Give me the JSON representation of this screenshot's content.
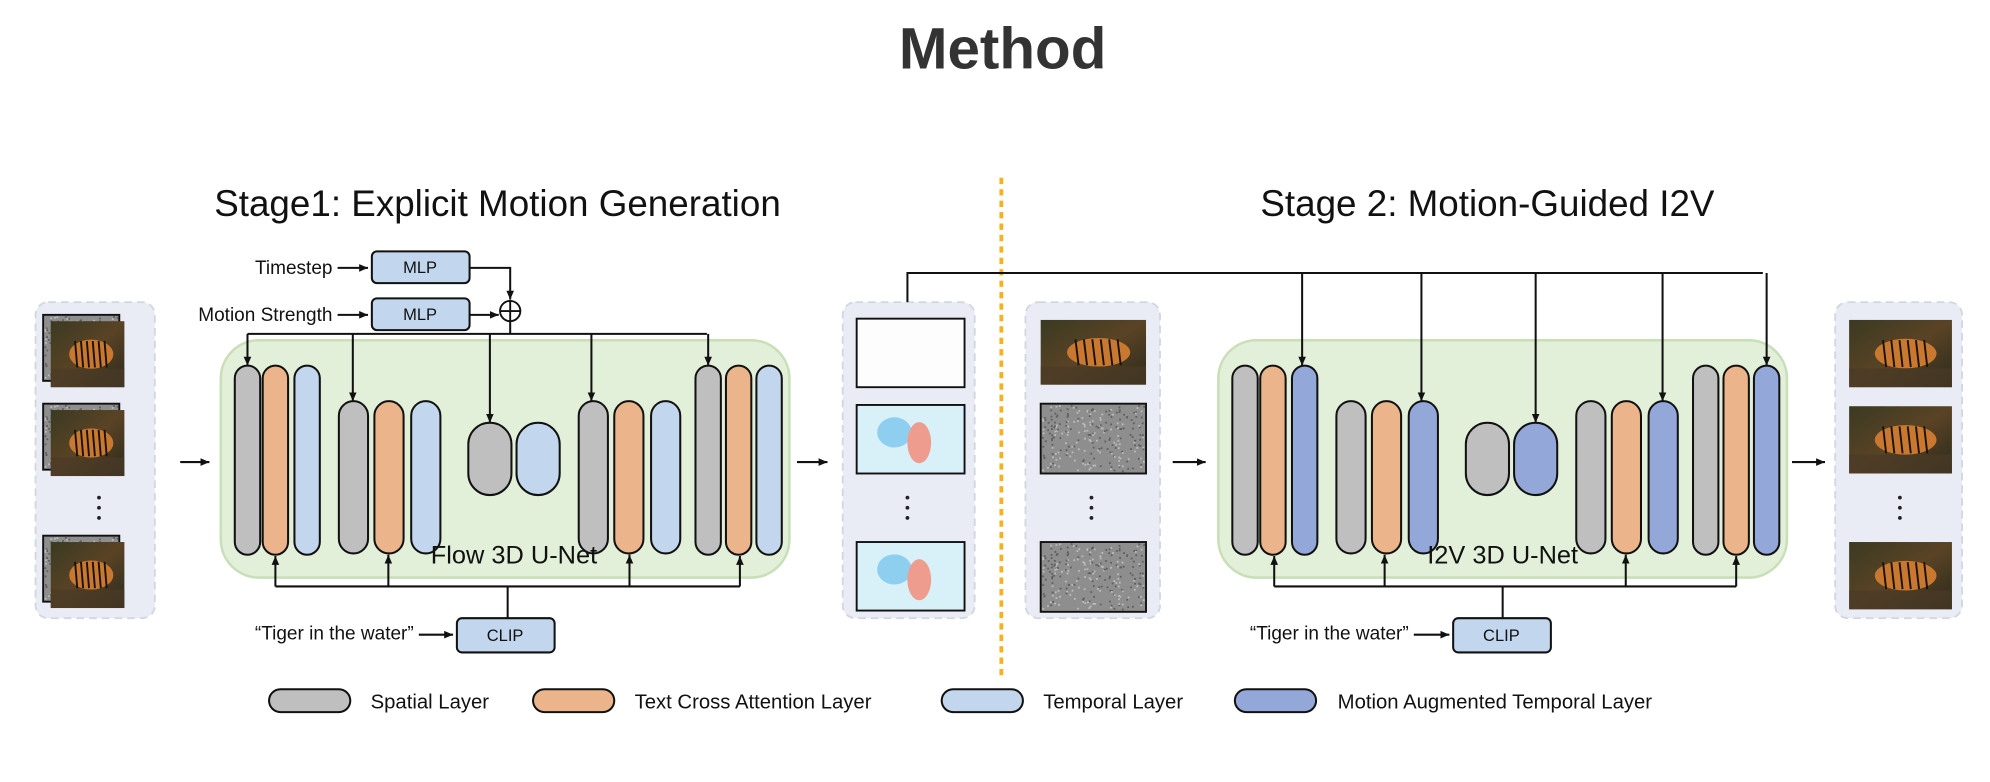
{
  "title": "Method",
  "stage1": {
    "title": "Stage1: Explicit Motion Generation",
    "timestep_label": "Timestep",
    "motion_strength_label": "Motion Strength",
    "mlp_label": "MLP",
    "unet_label": "Flow 3D U-Net",
    "prompt": "“Tiger in the water”",
    "clip_label": "CLIP"
  },
  "stage2": {
    "title": "Stage 2: Motion-Guided I2V",
    "unet_label": "I2V 3D U-Net",
    "prompt": "“Tiger in the water”",
    "clip_label": "CLIP"
  },
  "legend": [
    {
      "label": "Spatial Layer",
      "color": "#bfbfbf"
    },
    {
      "label": "Text Cross Attention Layer",
      "color": "#ecb48b"
    },
    {
      "label": "Temporal Layer",
      "color": "#c2d6ee"
    },
    {
      "label": "Motion Augmented Temporal Layer",
      "color": "#93a8d8"
    }
  ],
  "colors": {
    "unet_bg": "#e2efd9",
    "panel_bg": "#e9ecf4",
    "divider": "#f5b21c"
  }
}
